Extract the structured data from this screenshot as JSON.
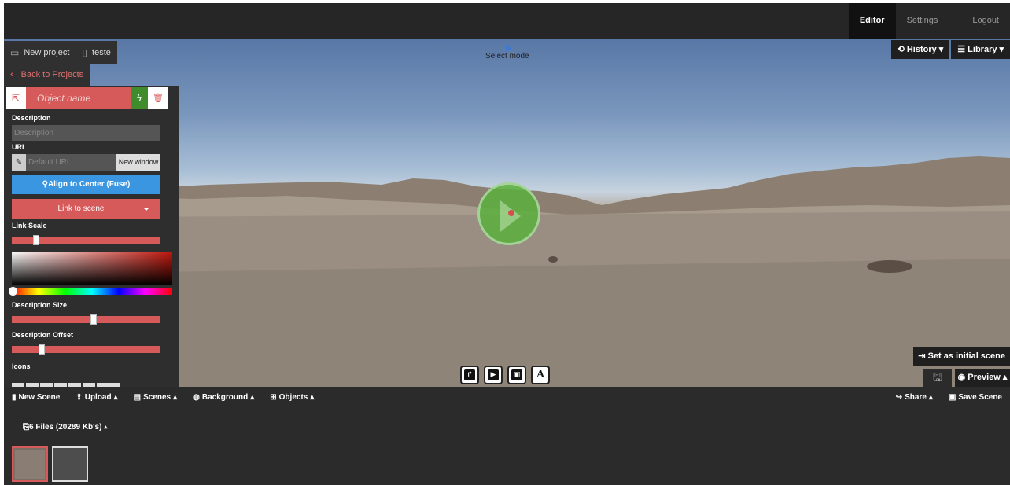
{
  "topnav": {
    "editor": "Editor",
    "settings": "Settings",
    "logout": "Logout"
  },
  "breadcrumb": {
    "project": "New project",
    "scene": "teste"
  },
  "back_label": "Back to Projects",
  "viewport": {
    "mode": "Select mode",
    "history": "History",
    "library": "Library",
    "set_initial": "Set as initial scene",
    "preview": "Preview",
    "media_buttons": [
      "link-icon",
      "video-icon",
      "image-icon",
      "text-icon"
    ],
    "text_button_label": "A"
  },
  "object_panel": {
    "name_placeholder": "Object name",
    "description_label": "Description",
    "description_placeholder": "Description",
    "url_label": "URL",
    "url_placeholder": "Default URL",
    "new_window": "New window",
    "align_center": "Align to Center (Fuse)",
    "link_to_scene": "Link to scene",
    "link_scale_label": "Link Scale",
    "link_scale_value": 0.15,
    "description_size_label": "Description Size",
    "description_size_value": 0.55,
    "description_offset_label": "Description Offset",
    "description_offset_value": 0.19,
    "icons_label": "Icons",
    "colors": {
      "accent": "#d65a5a",
      "fuse": "#3a96e0",
      "lightning": "#3e8c2c"
    }
  },
  "bottom_menu": {
    "left": [
      "New Scene",
      "Upload",
      "Scenes",
      "Background",
      "Objects"
    ],
    "right": [
      "Share",
      "Save Scene"
    ]
  },
  "files_label": "6 Files (20289 Kb's)"
}
